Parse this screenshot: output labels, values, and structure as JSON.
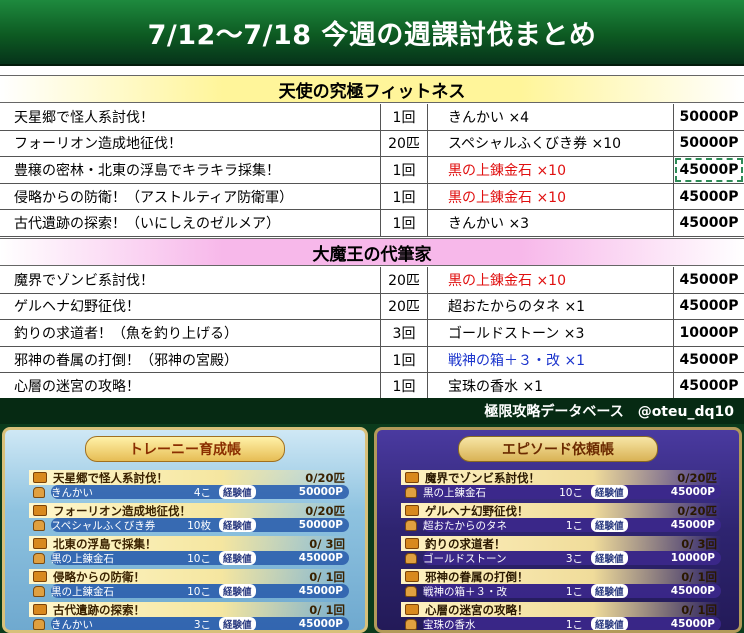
{
  "title": "7/12〜7/18 今週の週課討伐まとめ",
  "sections": [
    {
      "name": "天使の究極フィットネス",
      "rows": [
        {
          "task": "天星郷で怪人系討伐！",
          "count": "1回",
          "reward": "きんかい ×4",
          "points": "50000P",
          "color": "",
          "highlight": false
        },
        {
          "task": "フォーリオン造成地征伐！",
          "count": "20匹",
          "reward": "スペシャルふくびき券 ×10",
          "points": "50000P",
          "color": "",
          "highlight": false
        },
        {
          "task": "豊穣の密林・北東の浮島でキラキラ採集！",
          "count": "1回",
          "reward": "黒の上錬金石 ×10",
          "points": "45000P",
          "color": "red",
          "highlight": true
        },
        {
          "task": "侵略からの防衛！（アストルティア防衛軍）",
          "count": "1回",
          "reward": "黒の上錬金石 ×10",
          "points": "45000P",
          "color": "red",
          "highlight": false
        },
        {
          "task": "古代遺跡の探索！（いにしえのゼルメア）",
          "count": "1回",
          "reward": "きんかい ×3",
          "points": "45000P",
          "color": "",
          "highlight": false
        }
      ]
    },
    {
      "name": "大魔王の代筆家",
      "rows": [
        {
          "task": "魔界でゾンビ系討伐！",
          "count": "20匹",
          "reward": "黒の上錬金石 ×10",
          "points": "45000P",
          "color": "red",
          "highlight": false
        },
        {
          "task": "ゲルヘナ幻野征伐！",
          "count": "20匹",
          "reward": "超おたからのタネ ×1",
          "points": "45000P",
          "color": "",
          "highlight": false
        },
        {
          "task": "釣りの求道者！（魚を釣り上げる）",
          "count": "3回",
          "reward": "ゴールドストーン ×3",
          "points": "10000P",
          "color": "",
          "highlight": false
        },
        {
          "task": "邪神の眷属の打倒！（邪神の宮殿）",
          "count": "1回",
          "reward": "戦神の箱＋３・改 ×1",
          "points": "45000P",
          "color": "blue",
          "highlight": false
        },
        {
          "task": "心層の迷宮の攻略！",
          "count": "1回",
          "reward": "宝珠の香水 ×1",
          "points": "45000P",
          "color": "",
          "highlight": false
        }
      ]
    }
  ],
  "credit": "極限攻略データベース　@oteu_dq10",
  "game": {
    "left": {
      "title": "トレーニー育成帳",
      "badge": "経験値",
      "quests": [
        {
          "title": "天星郷で怪人系討伐！",
          "progress": "0/20匹",
          "reward": "きんかい",
          "num": "4こ",
          "points": "50000P"
        },
        {
          "title": "フォーリオン造成地征伐！",
          "progress": "0/20匹",
          "reward": "スペシャルふくびき券",
          "num": "10枚",
          "points": "50000P"
        },
        {
          "title": "北東の浮島で採集！",
          "progress": "0/ 3回",
          "reward": "黒の上錬金石",
          "num": "10こ",
          "points": "45000P"
        },
        {
          "title": "侵略からの防衛！",
          "progress": "0/ 1回",
          "reward": "黒の上錬金石",
          "num": "10こ",
          "points": "45000P"
        },
        {
          "title": "古代遺跡の探索！",
          "progress": "0/ 1回",
          "reward": "きんかい",
          "num": "3こ",
          "points": "45000P"
        }
      ]
    },
    "right": {
      "title": "エピソード依頼帳",
      "badge": "経験値",
      "quests": [
        {
          "title": "魔界でゾンビ系討伐！",
          "progress": "0/20匹",
          "reward": "黒の上錬金石",
          "num": "10こ",
          "points": "45000P"
        },
        {
          "title": "ゲルヘナ幻野征伐！",
          "progress": "0/20匹",
          "reward": "超おたからのタネ",
          "num": "1こ",
          "points": "45000P"
        },
        {
          "title": "釣りの求道者！",
          "progress": "0/ 3回",
          "reward": "ゴールドストーン",
          "num": "3こ",
          "points": "10000P"
        },
        {
          "title": "邪神の眷属の打倒！",
          "progress": "0/ 1回",
          "reward": "戦神の箱＋３・改",
          "num": "1こ",
          "points": "45000P"
        },
        {
          "title": "心層の迷宮の攻略！",
          "progress": "0/ 1回",
          "reward": "宝珠の香水",
          "num": "1こ",
          "points": "45000P"
        }
      ]
    }
  }
}
